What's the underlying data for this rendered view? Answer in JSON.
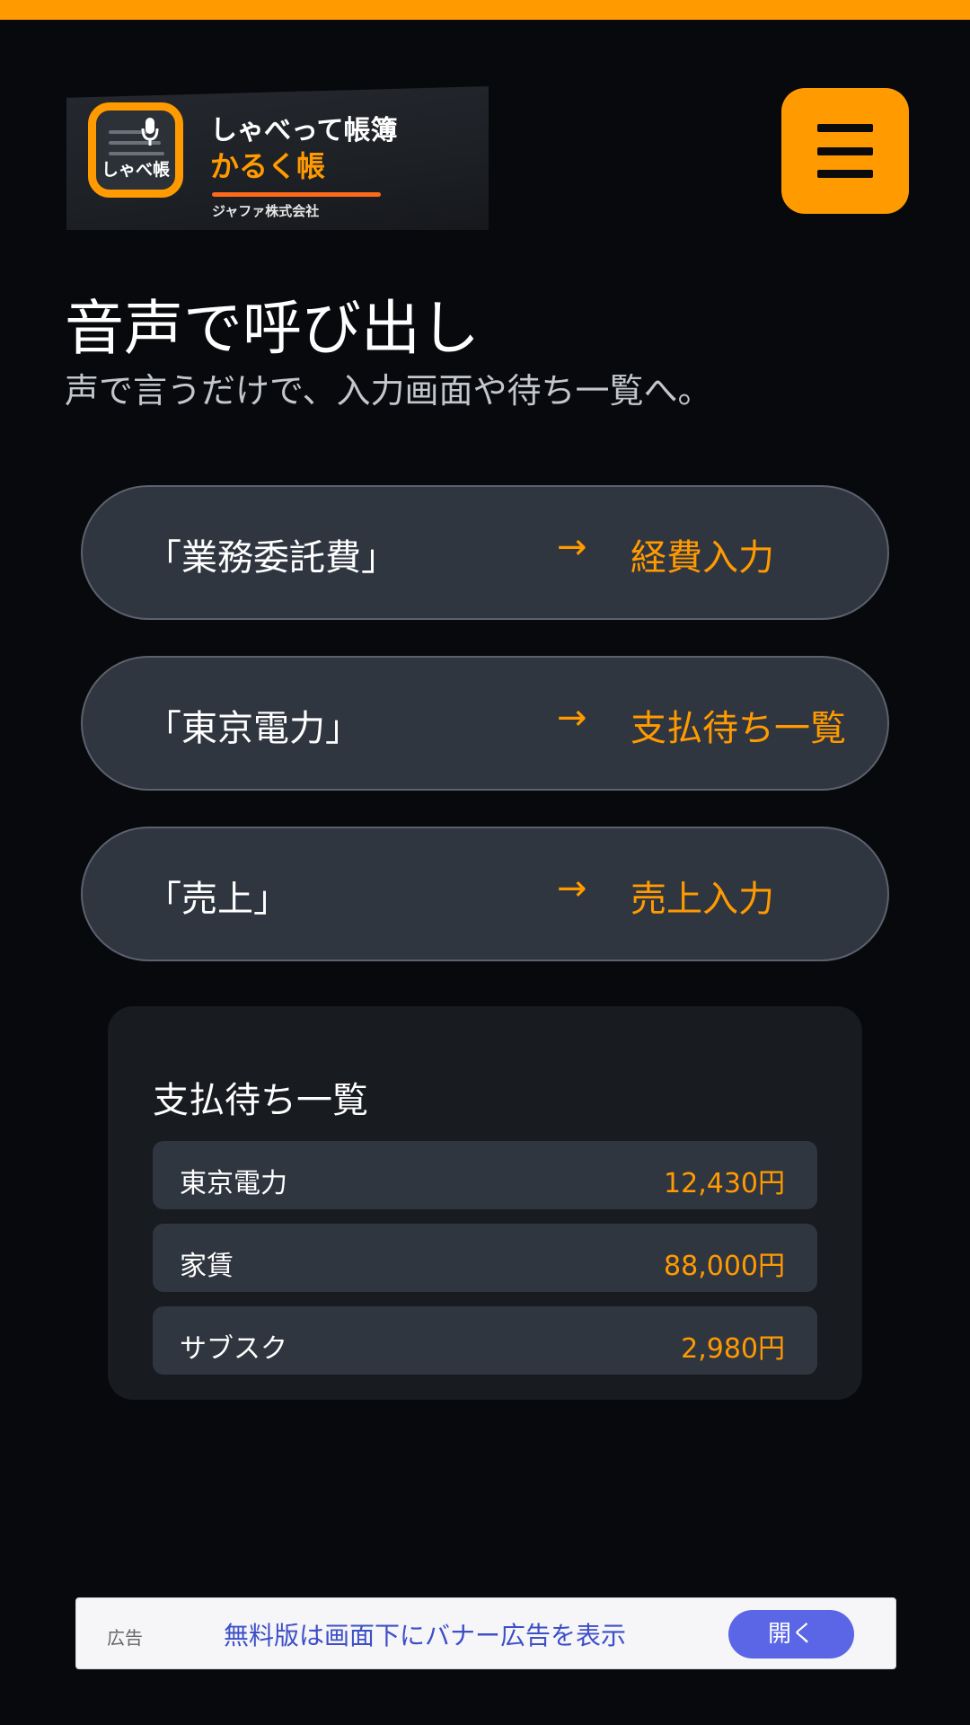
{
  "logo": {
    "icon_text": "しゃべ帳",
    "title": "しゃべって帳簿",
    "subtitle": "かるく帳",
    "company": "ジャファ株式会社"
  },
  "header": {
    "menu_icon": "hamburger-menu-icon"
  },
  "page": {
    "title": "音声で呼び出し",
    "subtitle": "声で言うだけで、入力画面や待ち一覧へ。"
  },
  "commands": [
    {
      "phrase": "「業務委託費」",
      "arrow": "→",
      "target": "経費入力"
    },
    {
      "phrase": "「東京電力」",
      "arrow": "→",
      "target": "支払待ち一覧"
    },
    {
      "phrase": "「売上」",
      "arrow": "→",
      "target": "売上入力"
    }
  ],
  "pending": {
    "title": "支払待ち一覧",
    "rows": [
      {
        "name": "東京電力",
        "amount": "12,430円"
      },
      {
        "name": "家賃",
        "amount": "88,000円"
      },
      {
        "name": "サブスク",
        "amount": "2,980円"
      }
    ]
  },
  "ad": {
    "label": "広告",
    "text": "無料版は画面下にバナー広告を表示",
    "button": "開く"
  },
  "colors": {
    "background": "#07090c",
    "accent": "#ff9a00",
    "pill": "#303640",
    "ad_button": "#5b66e6"
  }
}
